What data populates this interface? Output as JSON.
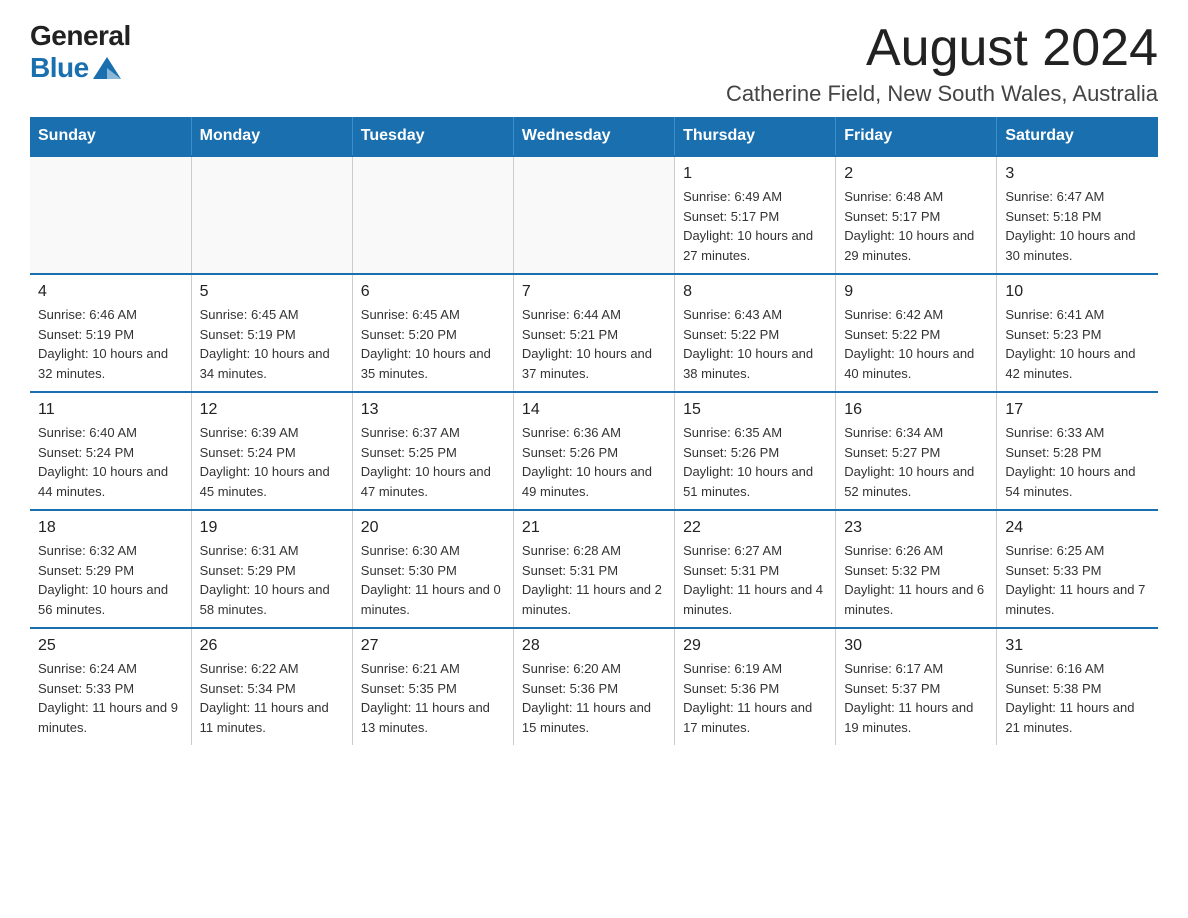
{
  "header": {
    "logo_general": "General",
    "logo_blue": "Blue",
    "month_title": "August 2024",
    "location": "Catherine Field, New South Wales, Australia"
  },
  "days_of_week": [
    "Sunday",
    "Monday",
    "Tuesday",
    "Wednesday",
    "Thursday",
    "Friday",
    "Saturday"
  ],
  "weeks": [
    [
      {
        "day": "",
        "info": ""
      },
      {
        "day": "",
        "info": ""
      },
      {
        "day": "",
        "info": ""
      },
      {
        "day": "",
        "info": ""
      },
      {
        "day": "1",
        "info": "Sunrise: 6:49 AM\nSunset: 5:17 PM\nDaylight: 10 hours and 27 minutes."
      },
      {
        "day": "2",
        "info": "Sunrise: 6:48 AM\nSunset: 5:17 PM\nDaylight: 10 hours and 29 minutes."
      },
      {
        "day": "3",
        "info": "Sunrise: 6:47 AM\nSunset: 5:18 PM\nDaylight: 10 hours and 30 minutes."
      }
    ],
    [
      {
        "day": "4",
        "info": "Sunrise: 6:46 AM\nSunset: 5:19 PM\nDaylight: 10 hours and 32 minutes."
      },
      {
        "day": "5",
        "info": "Sunrise: 6:45 AM\nSunset: 5:19 PM\nDaylight: 10 hours and 34 minutes."
      },
      {
        "day": "6",
        "info": "Sunrise: 6:45 AM\nSunset: 5:20 PM\nDaylight: 10 hours and 35 minutes."
      },
      {
        "day": "7",
        "info": "Sunrise: 6:44 AM\nSunset: 5:21 PM\nDaylight: 10 hours and 37 minutes."
      },
      {
        "day": "8",
        "info": "Sunrise: 6:43 AM\nSunset: 5:22 PM\nDaylight: 10 hours and 38 minutes."
      },
      {
        "day": "9",
        "info": "Sunrise: 6:42 AM\nSunset: 5:22 PM\nDaylight: 10 hours and 40 minutes."
      },
      {
        "day": "10",
        "info": "Sunrise: 6:41 AM\nSunset: 5:23 PM\nDaylight: 10 hours and 42 minutes."
      }
    ],
    [
      {
        "day": "11",
        "info": "Sunrise: 6:40 AM\nSunset: 5:24 PM\nDaylight: 10 hours and 44 minutes."
      },
      {
        "day": "12",
        "info": "Sunrise: 6:39 AM\nSunset: 5:24 PM\nDaylight: 10 hours and 45 minutes."
      },
      {
        "day": "13",
        "info": "Sunrise: 6:37 AM\nSunset: 5:25 PM\nDaylight: 10 hours and 47 minutes."
      },
      {
        "day": "14",
        "info": "Sunrise: 6:36 AM\nSunset: 5:26 PM\nDaylight: 10 hours and 49 minutes."
      },
      {
        "day": "15",
        "info": "Sunrise: 6:35 AM\nSunset: 5:26 PM\nDaylight: 10 hours and 51 minutes."
      },
      {
        "day": "16",
        "info": "Sunrise: 6:34 AM\nSunset: 5:27 PM\nDaylight: 10 hours and 52 minutes."
      },
      {
        "day": "17",
        "info": "Sunrise: 6:33 AM\nSunset: 5:28 PM\nDaylight: 10 hours and 54 minutes."
      }
    ],
    [
      {
        "day": "18",
        "info": "Sunrise: 6:32 AM\nSunset: 5:29 PM\nDaylight: 10 hours and 56 minutes."
      },
      {
        "day": "19",
        "info": "Sunrise: 6:31 AM\nSunset: 5:29 PM\nDaylight: 10 hours and 58 minutes."
      },
      {
        "day": "20",
        "info": "Sunrise: 6:30 AM\nSunset: 5:30 PM\nDaylight: 11 hours and 0 minutes."
      },
      {
        "day": "21",
        "info": "Sunrise: 6:28 AM\nSunset: 5:31 PM\nDaylight: 11 hours and 2 minutes."
      },
      {
        "day": "22",
        "info": "Sunrise: 6:27 AM\nSunset: 5:31 PM\nDaylight: 11 hours and 4 minutes."
      },
      {
        "day": "23",
        "info": "Sunrise: 6:26 AM\nSunset: 5:32 PM\nDaylight: 11 hours and 6 minutes."
      },
      {
        "day": "24",
        "info": "Sunrise: 6:25 AM\nSunset: 5:33 PM\nDaylight: 11 hours and 7 minutes."
      }
    ],
    [
      {
        "day": "25",
        "info": "Sunrise: 6:24 AM\nSunset: 5:33 PM\nDaylight: 11 hours and 9 minutes."
      },
      {
        "day": "26",
        "info": "Sunrise: 6:22 AM\nSunset: 5:34 PM\nDaylight: 11 hours and 11 minutes."
      },
      {
        "day": "27",
        "info": "Sunrise: 6:21 AM\nSunset: 5:35 PM\nDaylight: 11 hours and 13 minutes."
      },
      {
        "day": "28",
        "info": "Sunrise: 6:20 AM\nSunset: 5:36 PM\nDaylight: 11 hours and 15 minutes."
      },
      {
        "day": "29",
        "info": "Sunrise: 6:19 AM\nSunset: 5:36 PM\nDaylight: 11 hours and 17 minutes."
      },
      {
        "day": "30",
        "info": "Sunrise: 6:17 AM\nSunset: 5:37 PM\nDaylight: 11 hours and 19 minutes."
      },
      {
        "day": "31",
        "info": "Sunrise: 6:16 AM\nSunset: 5:38 PM\nDaylight: 11 hours and 21 minutes."
      }
    ]
  ]
}
